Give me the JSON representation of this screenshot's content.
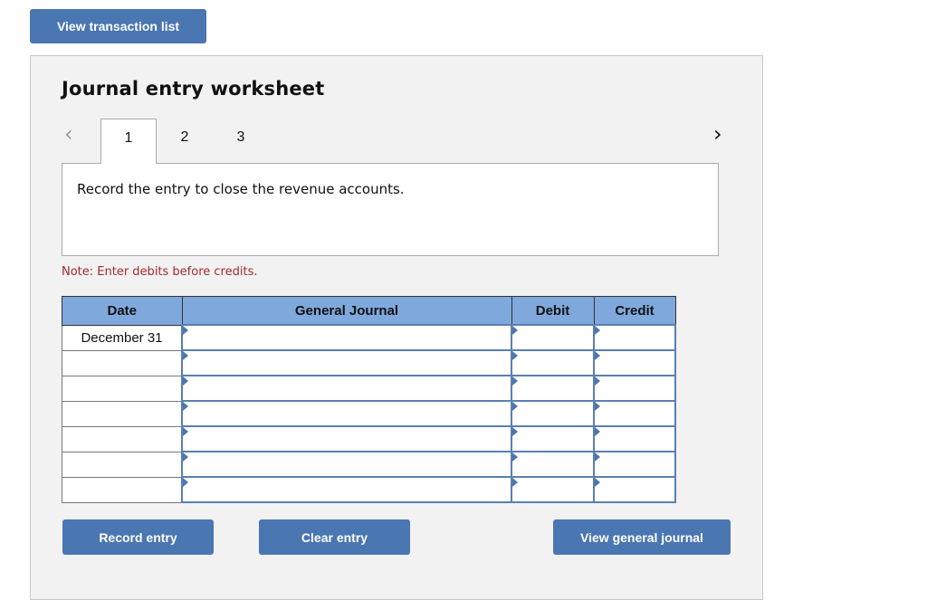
{
  "top_button": "View transaction list",
  "worksheet": {
    "title": "Journal entry worksheet",
    "prev_icon": "chevron-left-icon",
    "next_icon": "chevron-right-icon",
    "tabs": [
      "1",
      "2",
      "3"
    ],
    "active_tab": "1",
    "prompt": "Record the entry to close the revenue accounts.",
    "note": "Note: Enter debits before credits."
  },
  "table": {
    "headers": [
      "Date",
      "General Journal",
      "Debit",
      "Credit"
    ],
    "rows": [
      {
        "date": "December 31",
        "account": "",
        "debit": "",
        "credit": ""
      },
      {
        "date": "",
        "account": "",
        "debit": "",
        "credit": ""
      },
      {
        "date": "",
        "account": "",
        "debit": "",
        "credit": ""
      },
      {
        "date": "",
        "account": "",
        "debit": "",
        "credit": ""
      },
      {
        "date": "",
        "account": "",
        "debit": "",
        "credit": ""
      },
      {
        "date": "",
        "account": "",
        "debit": "",
        "credit": ""
      },
      {
        "date": "",
        "account": "",
        "debit": "",
        "credit": ""
      }
    ]
  },
  "buttons": {
    "record": "Record entry",
    "clear": "Clear entry",
    "view_journal": "View general journal"
  },
  "colors": {
    "button": "#4a76b2",
    "header": "#7fa8dc",
    "note": "#a52a2a"
  }
}
